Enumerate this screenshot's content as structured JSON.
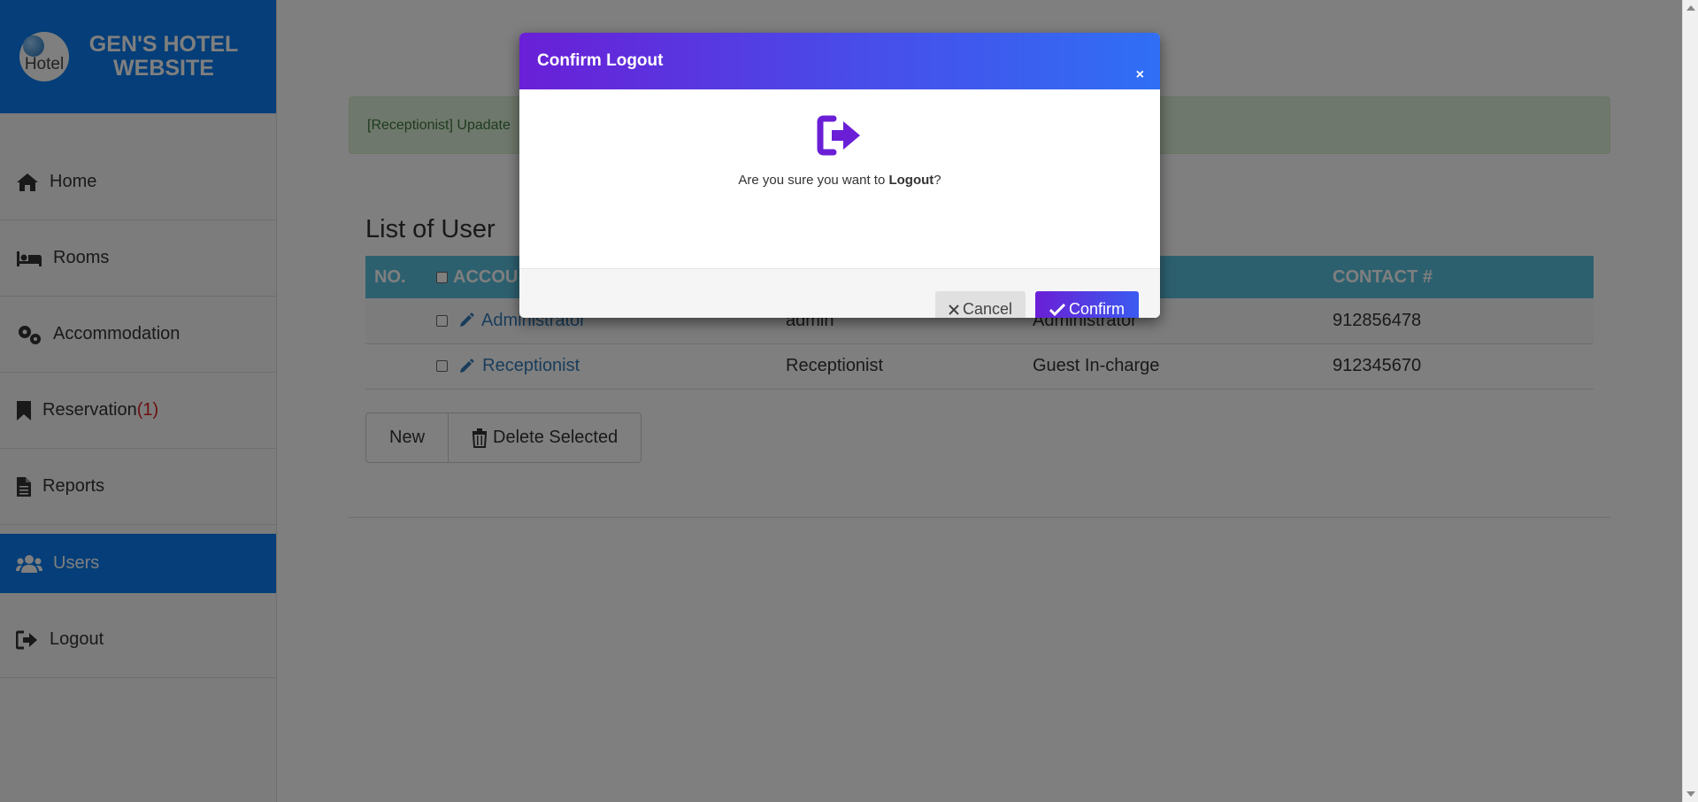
{
  "brand": {
    "logo_text": "Hotel",
    "title": "GEN'S HOTEL WEBSITE"
  },
  "nav": [
    {
      "label": "Home",
      "icon": "home-icon"
    },
    {
      "label": "Rooms",
      "icon": "bed-icon"
    },
    {
      "label": "Accommodation",
      "icon": "gears-icon"
    },
    {
      "label": "Reservation",
      "badge": "(1)",
      "icon": "bookmark-icon"
    },
    {
      "label": "Reports",
      "icon": "file-icon"
    },
    {
      "label": "Users",
      "icon": "users-icon",
      "active": true
    },
    {
      "label": "Logout",
      "icon": "sign-out-icon"
    }
  ],
  "main": {
    "alert": "[Receptionist] Upadate",
    "list_title": "List of User",
    "table": {
      "headers": [
        "NO.",
        "ACCOU",
        "",
        "",
        "CONTACT #"
      ],
      "rows": [
        {
          "account": "Administrator",
          "username": "admin",
          "role": "Administrator",
          "contact": "912856478"
        },
        {
          "account": "Receptionist",
          "username": "Receptionist",
          "role": "Guest In-charge",
          "contact": "912345670"
        }
      ]
    },
    "buttons": {
      "new": "New",
      "delete": "Delete Selected"
    }
  },
  "modal": {
    "title": "Confirm Logout",
    "close": "×",
    "question_prefix": "Are you sure you want to ",
    "question_bold": "Logout",
    "question_suffix": "?",
    "cancel": "Cancel",
    "confirm": "Confirm",
    "icon": "sign-out-icon"
  },
  "colors": {
    "brand_blue": "#0a7cf0",
    "table_header": "#5bc0de",
    "alert_bg": "#dff0d8",
    "modal_purple": "#6a1fd6",
    "modal_blue": "#2f6ff5",
    "badge_red": "#d9211b"
  }
}
